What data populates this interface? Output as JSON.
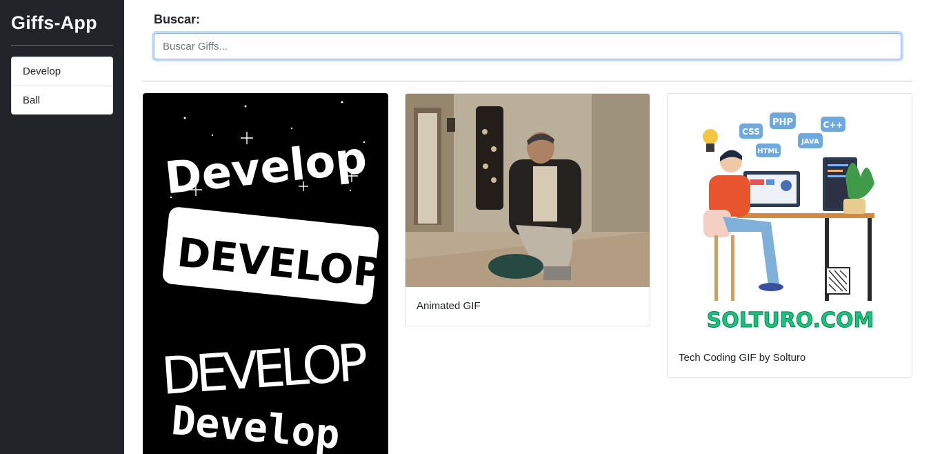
{
  "sidebar": {
    "brand": "Giffs-App",
    "history": [
      "Develop",
      "Ball"
    ]
  },
  "search": {
    "label": "Buscar:",
    "placeholder": "Buscar Giffs...",
    "value": ""
  },
  "gifs": [
    {
      "title": "",
      "image_text": [
        "Develop",
        "DEVELOP",
        "DEVELOP",
        "Develop"
      ]
    },
    {
      "title": "Animated GIF"
    },
    {
      "title": "Tech Coding GIF by Solturo",
      "image_text": {
        "bubbles": [
          "CSS",
          "PHP",
          "C++",
          "HTML",
          "JAVA"
        ],
        "brand": "SOLTURO.COM"
      }
    }
  ],
  "colors": {
    "sidebar_bg": "#212529",
    "focus_border": "#86b7fe",
    "solturo_green": "#19c37d",
    "bubble_blue": "#6fa8dc"
  }
}
